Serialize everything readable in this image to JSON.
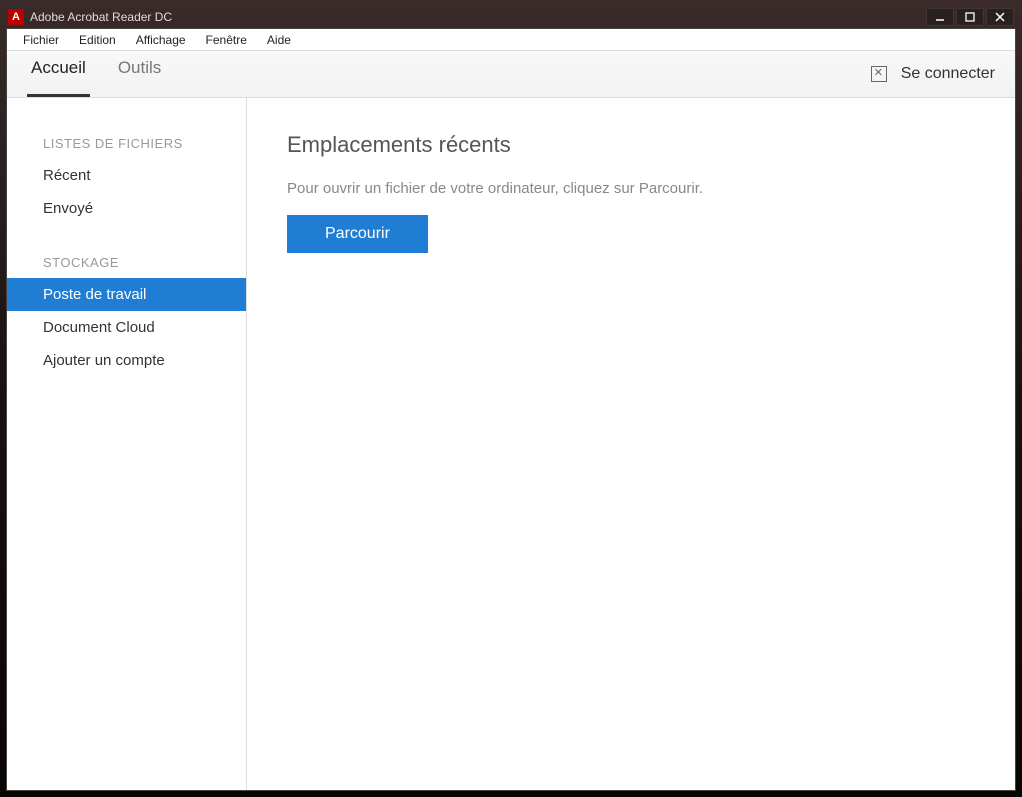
{
  "titlebar": {
    "icon_letter": "A",
    "title": "Adobe Acrobat Reader DC"
  },
  "menubar": {
    "items": [
      "Fichier",
      "Edition",
      "Affichage",
      "Fenêtre",
      "Aide"
    ]
  },
  "tabbar": {
    "tabs": [
      {
        "label": "Accueil",
        "active": true
      },
      {
        "label": "Outils",
        "active": false
      }
    ],
    "signin_label": "Se connecter"
  },
  "sidebar": {
    "sections": [
      {
        "heading": "LISTES DE FICHIERS",
        "items": [
          {
            "label": "Récent",
            "selected": false
          },
          {
            "label": "Envoyé",
            "selected": false
          }
        ]
      },
      {
        "heading": "STOCKAGE",
        "items": [
          {
            "label": "Poste de travail",
            "selected": true
          },
          {
            "label": "Document Cloud",
            "selected": false
          },
          {
            "label": "Ajouter un compte",
            "selected": false
          }
        ]
      }
    ]
  },
  "main": {
    "title": "Emplacements récents",
    "hint": "Pour ouvrir un fichier de votre ordinateur, cliquez sur Parcourir.",
    "browse_label": "Parcourir"
  }
}
